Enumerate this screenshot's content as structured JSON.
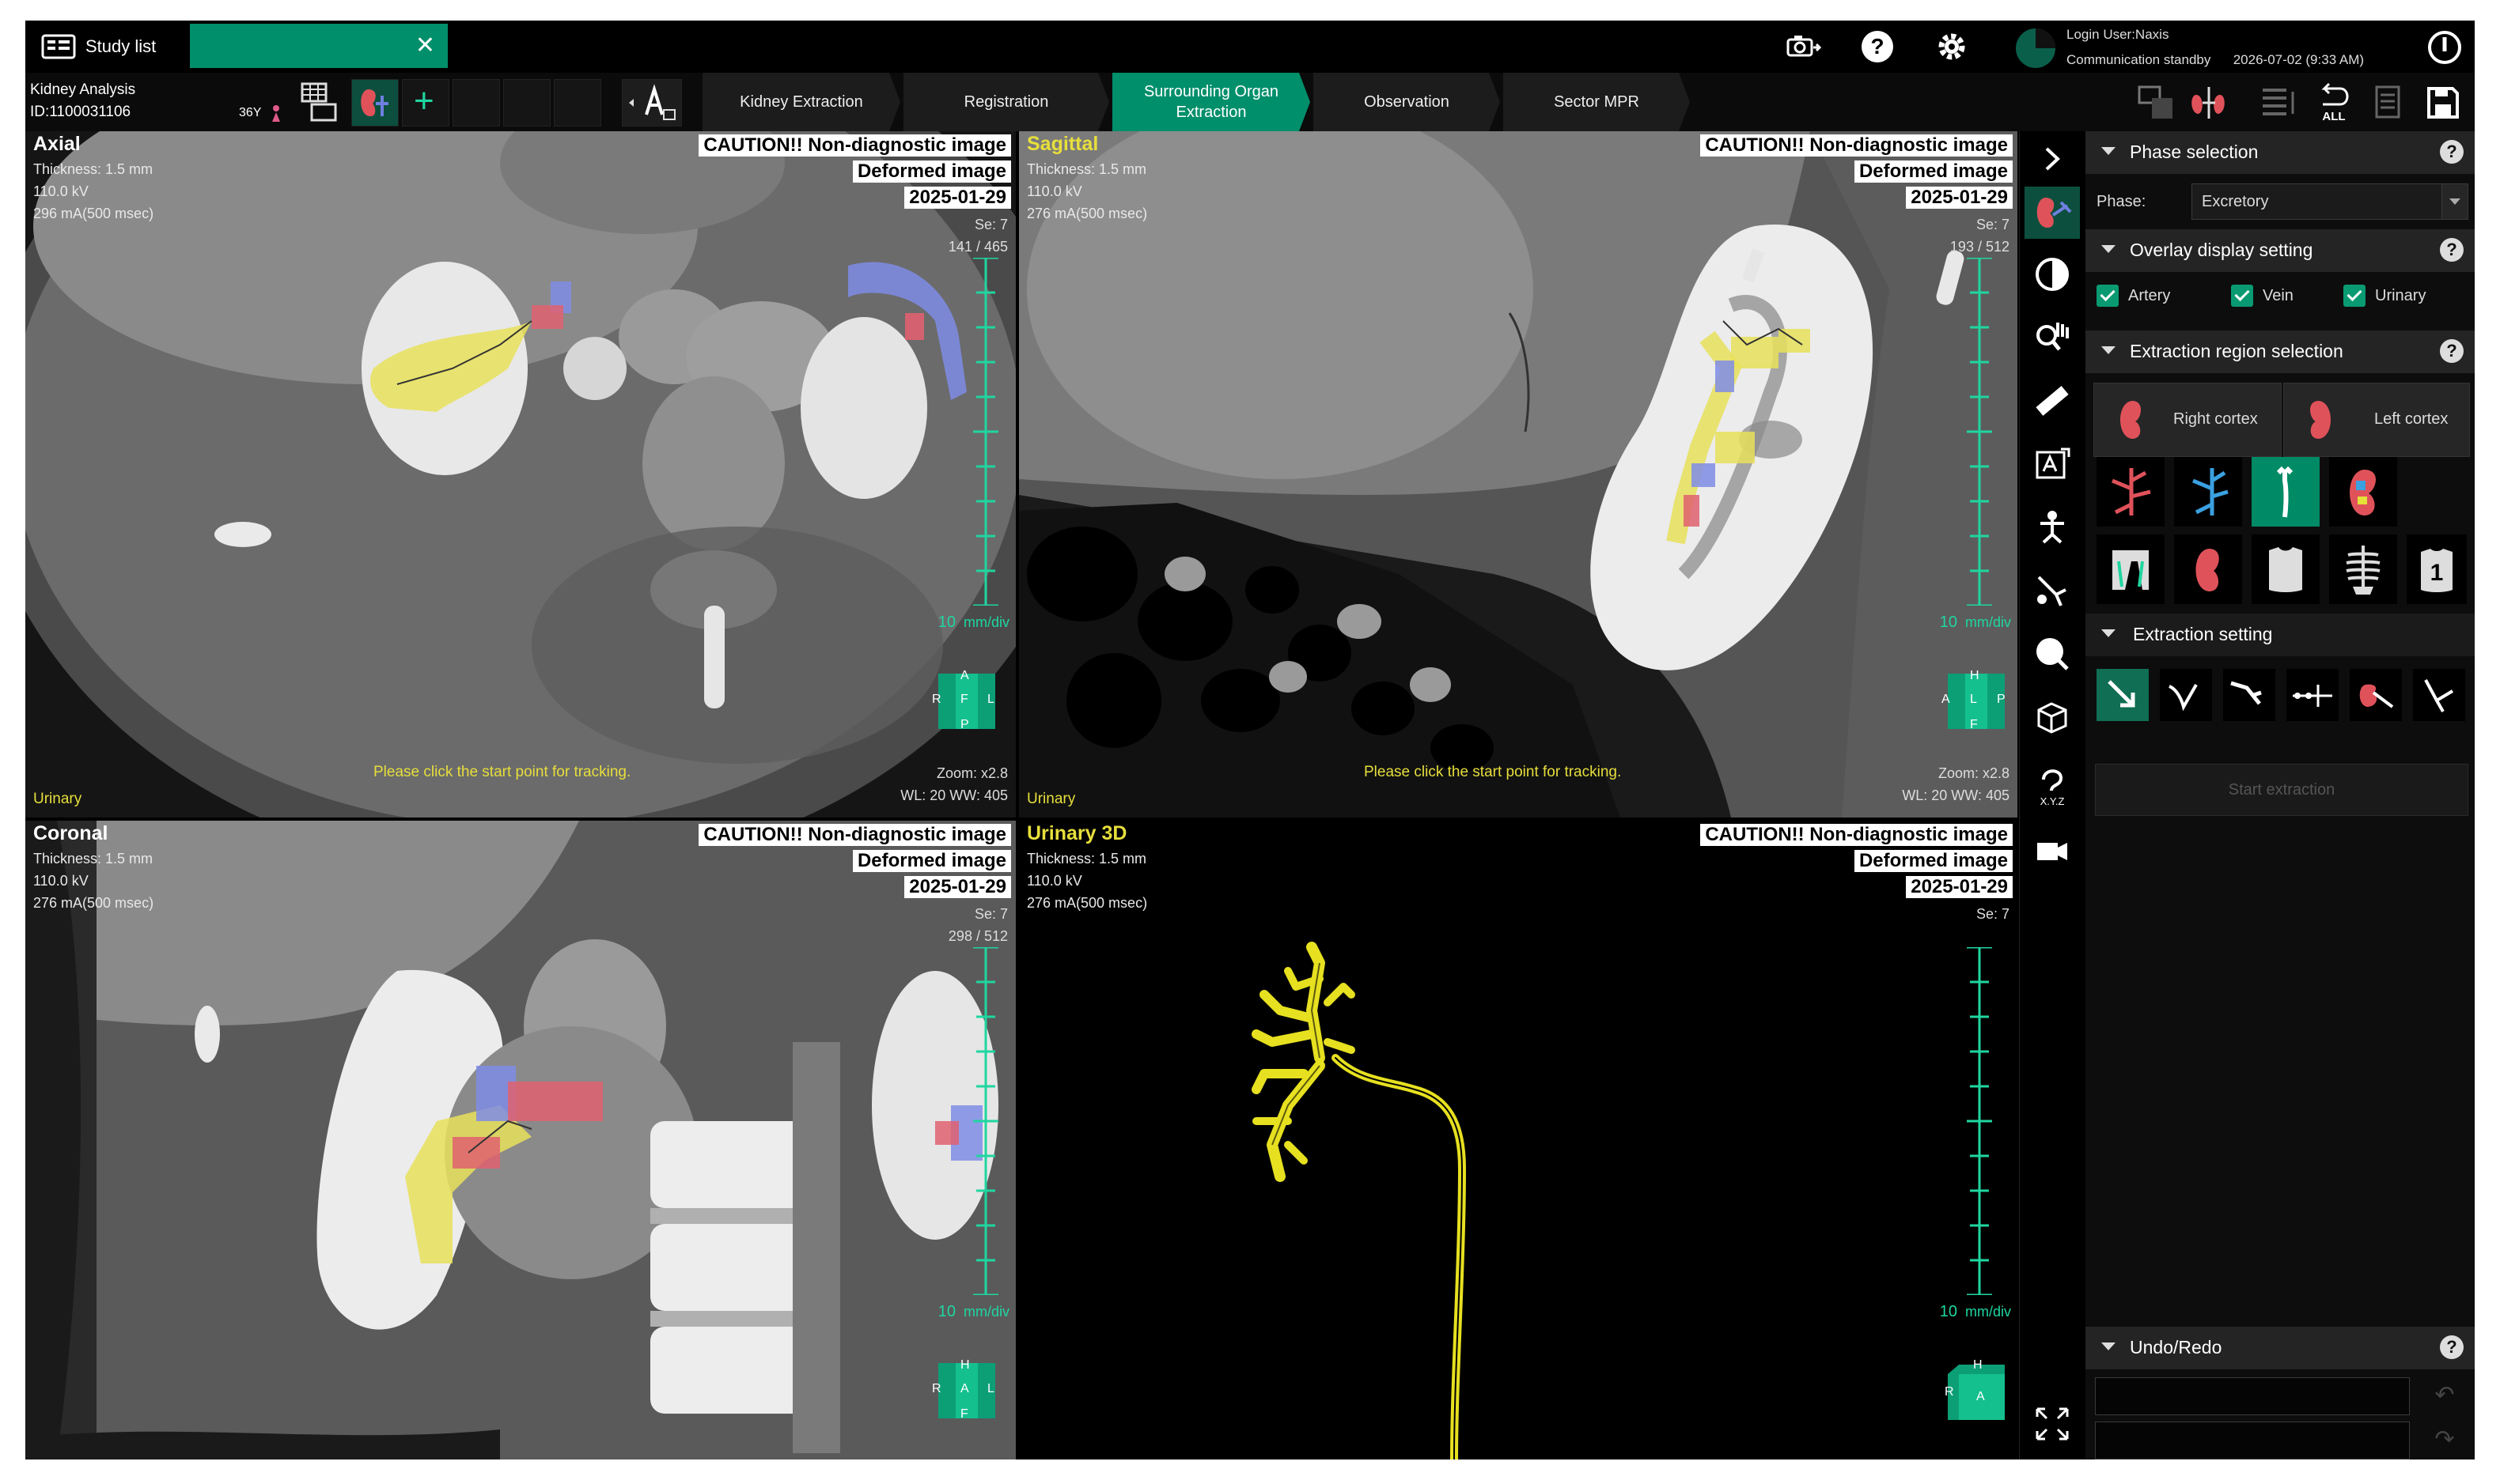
{
  "titlebar": {
    "study_list_label": "Study list",
    "close_tab_label": "✕",
    "login_user": "Login User:Naxis",
    "comm_status": "Communication standby",
    "datetime": "2026-07-02 (9:33 AM)"
  },
  "patient": {
    "analysis_name": "Kidney Analysis",
    "id": "ID:1100031106",
    "age": "36Y"
  },
  "toolbar": {
    "add_label": "+"
  },
  "workflow": {
    "steps": [
      {
        "label": "Kidney Extraction"
      },
      {
        "label": "Registration"
      },
      {
        "label": "Surrounding Organ Extraction"
      },
      {
        "label": "Observation"
      },
      {
        "label": "Sector MPR"
      }
    ],
    "active_step": "Surrounding Organ Extraction"
  },
  "viewports": {
    "axial": {
      "title": "Axial",
      "thickness": "Thickness: 1.5 mm",
      "kv": "110.0 kV",
      "ma": "296 mA(500 msec)",
      "caution": "CAUTION!! Non-diagnostic image",
      "deformed": "Deformed image",
      "date": "2025-01-29",
      "series": "Se: 7",
      "slice": "141 / 465",
      "mmdiv_value": "10",
      "mmdiv_unit": "mm/div",
      "orient": {
        "top": "A",
        "left": "R",
        "center": "F",
        "right": "L",
        "bottom": "P"
      },
      "tracking": "Please click the start point for tracking.",
      "zoom": "Zoom: x2.8",
      "wlww": "WL: 20  WW: 405",
      "phase": "Urinary"
    },
    "sagittal": {
      "title": "Sagittal",
      "thickness": "Thickness: 1.5 mm",
      "kv": "110.0 kV",
      "ma": "276 mA(500 msec)",
      "caution": "CAUTION!! Non-diagnostic image",
      "deformed": "Deformed image",
      "date": "2025-01-29",
      "series": "Se: 7",
      "slice": "193 / 512",
      "mmdiv_value": "10",
      "mmdiv_unit": "mm/div",
      "orient": {
        "top": "H",
        "left": "A",
        "center": "L",
        "right": "P",
        "bottom": "F"
      },
      "tracking": "Please click the start point for tracking.",
      "zoom": "Zoom: x2.8",
      "wlww": "WL: 20  WW: 405",
      "phase": "Urinary"
    },
    "coronal": {
      "title": "Coronal",
      "thickness": "Thickness: 1.5 mm",
      "kv": "110.0 kV",
      "ma": "276 mA(500 msec)",
      "caution": "CAUTION!! Non-diagnostic image",
      "deformed": "Deformed image",
      "date": "2025-01-29",
      "series": "Se: 7",
      "slice": "298 / 512",
      "mmdiv_value": "10",
      "mmdiv_unit": "mm/div",
      "orient": {
        "top": "H",
        "left": "R",
        "center": "A",
        "right": "L",
        "bottom": "F"
      }
    },
    "urinary3d": {
      "title": "Urinary 3D",
      "thickness": "Thickness: 1.5 mm",
      "kv": "110.0 kV",
      "ma": "276 mA(500 msec)",
      "caution": "CAUTION!! Non-diagnostic image",
      "deformed": "Deformed image",
      "date": "2025-01-29",
      "series": "Se: 7",
      "mmdiv_value": "10",
      "mmdiv_unit": "mm/div",
      "orient": {
        "top": "H",
        "left": "R",
        "center": "A"
      }
    }
  },
  "panel": {
    "phase_section": "Phase selection",
    "phase_label": "Phase:",
    "phase_value": "Excretory",
    "overlay_section": "Overlay display setting",
    "overlays": [
      {
        "label": "Artery"
      },
      {
        "label": "Vein"
      },
      {
        "label": "Urinary"
      }
    ],
    "extraction_region_section": "Extraction region selection",
    "right_cortex": "Right cortex",
    "left_cortex": "Left cortex",
    "extraction_setting_section": "Extraction setting",
    "start_extraction": "Start extraction",
    "undo_redo_section": "Undo/Redo",
    "help_label": "?"
  },
  "colors": {
    "accent": "#008f6b",
    "overlay_urinary": "#e6e03a",
    "overlay_artery": "#e0525a",
    "overlay_vein": "#6f7fe0",
    "scale_ruler": "#1fd6a0"
  }
}
